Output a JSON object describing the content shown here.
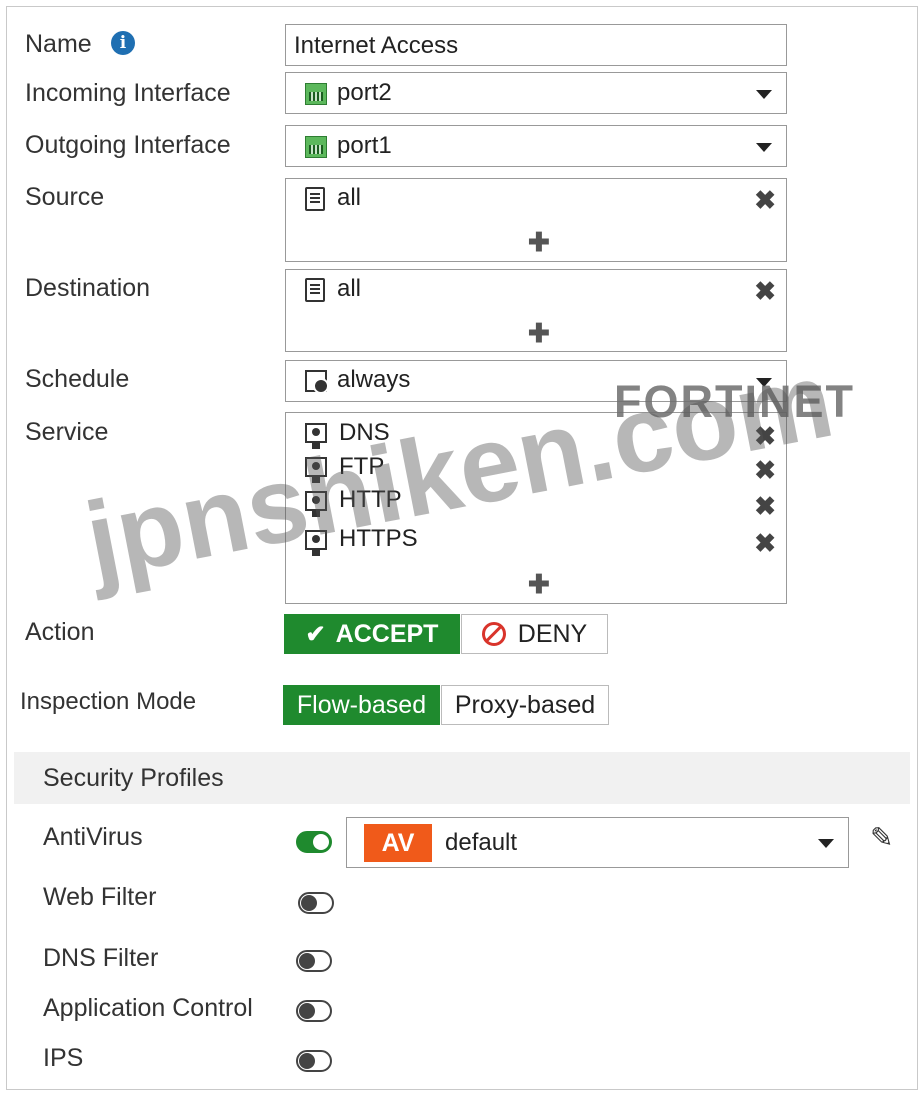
{
  "form": {
    "name": {
      "label": "Name",
      "value": "Internet Access"
    },
    "incoming_interface": {
      "label": "Incoming Interface",
      "value": "port2",
      "icon": "port-icon"
    },
    "outgoing_interface": {
      "label": "Outgoing Interface",
      "value": "port1",
      "icon": "port-icon"
    },
    "source": {
      "label": "Source",
      "items": [
        "all"
      ],
      "icon": "address-icon"
    },
    "destination": {
      "label": "Destination",
      "items": [
        "all"
      ],
      "icon": "address-icon"
    },
    "schedule": {
      "label": "Schedule",
      "value": "always",
      "icon": "schedule-icon"
    },
    "service": {
      "label": "Service",
      "items": [
        "DNS",
        "FTP",
        "HTTP",
        "HTTPS"
      ],
      "icon": "service-icon"
    },
    "action": {
      "label": "Action",
      "options": [
        "ACCEPT",
        "DENY"
      ],
      "selected": "ACCEPT"
    },
    "inspection_mode": {
      "label": "Inspection Mode",
      "options": [
        "Flow-based",
        "Proxy-based"
      ],
      "selected": "Flow-based"
    }
  },
  "security_profiles": {
    "header": "Security Profiles",
    "antivirus": {
      "label": "AntiVirus",
      "enabled": true,
      "badge": "AV",
      "value": "default"
    },
    "web_filter": {
      "label": "Web Filter",
      "enabled": false
    },
    "dns_filter": {
      "label": "DNS Filter",
      "enabled": false
    },
    "application_control": {
      "label": "Application Control",
      "enabled": false
    },
    "ips": {
      "label": "IPS",
      "enabled": false
    }
  },
  "watermarks": {
    "brand": "FORTINET",
    "site": "jpnshiken.com"
  },
  "colors": {
    "accept_green": "#1f8a2e",
    "av_orange": "#f05a1a",
    "info_blue": "#1f6fb2"
  }
}
